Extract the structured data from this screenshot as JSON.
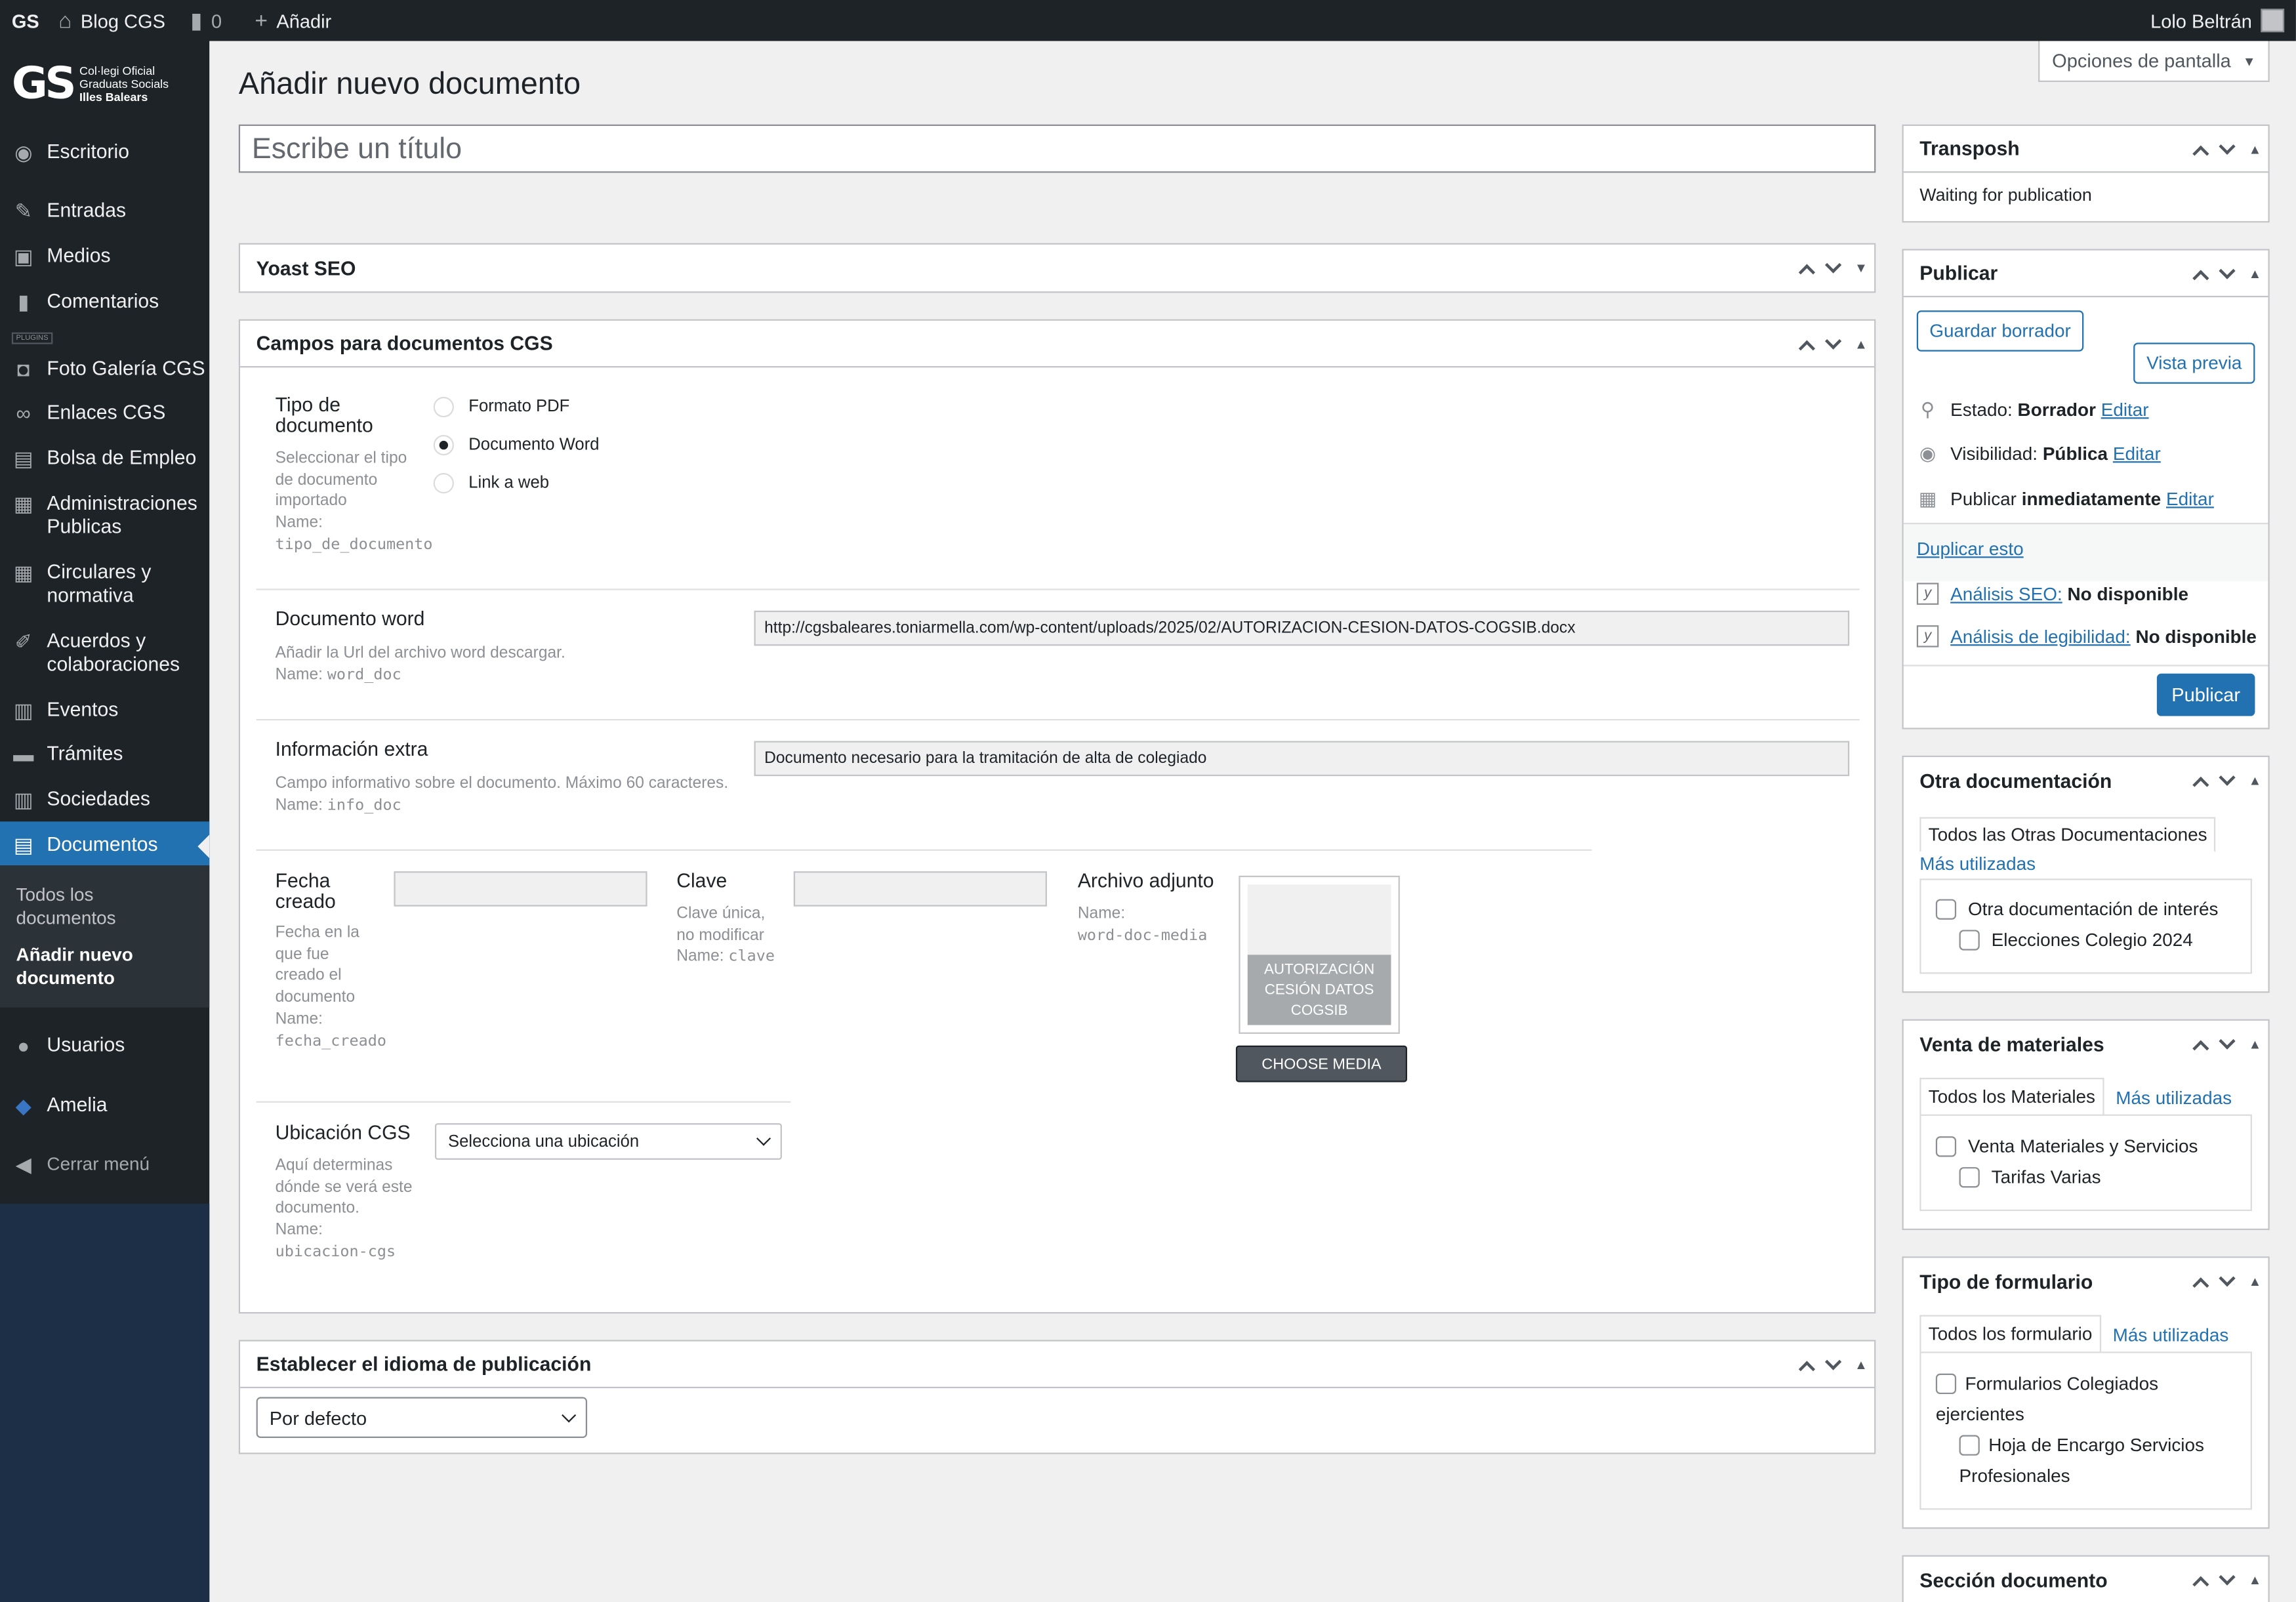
{
  "adminbar": {
    "logo": "GS",
    "site_name": "Blog CGS",
    "comments_count": "0",
    "add_label": "Añadir",
    "user_name": "Lolo Beltrán"
  },
  "brand": {
    "logo_letters": "GS",
    "line1": "Col·legi Oficial",
    "line2": "Graduats Socials",
    "line3": "Illes Balears"
  },
  "sidebar": {
    "items": [
      {
        "label": "Escritorio",
        "icon": "dashboard-icon"
      },
      {
        "label": "Entradas",
        "icon": "pin-icon"
      },
      {
        "label": "Medios",
        "icon": "media-icon"
      },
      {
        "label": "Comentarios",
        "icon": "comment-icon"
      },
      {
        "label": "Foto Galería CGS",
        "icon": "camera-icon"
      },
      {
        "label": "Enlaces CGS",
        "icon": "link-icon"
      },
      {
        "label": "Bolsa de Empleo",
        "icon": "portfolio-icon"
      },
      {
        "label": "Administraciones Publicas",
        "icon": "document-icon"
      },
      {
        "label": "Circulares y normativa",
        "icon": "document-icon"
      },
      {
        "label": "Acuerdos y colaboraciones",
        "icon": "edit-icon"
      },
      {
        "label": "Eventos",
        "icon": "calendar-icon"
      },
      {
        "label": "Trámites",
        "icon": "feedback-icon"
      },
      {
        "label": "Sociedades",
        "icon": "building-icon"
      },
      {
        "label": "Documentos",
        "icon": "documents-icon"
      },
      {
        "label": "Usuarios",
        "icon": "user-icon"
      },
      {
        "label": "Amelia",
        "icon": "amelia-icon"
      },
      {
        "label": "Cerrar menú",
        "icon": "collapse-icon"
      }
    ],
    "plugins_separator": "PLUGINS",
    "submenu": [
      "Todos los documentos",
      "Añadir nuevo documento"
    ]
  },
  "screen_options": "Opciones de pantalla",
  "page_title": "Añadir nuevo documento",
  "title_placeholder": "Escribe un título",
  "yoast_box": {
    "title": "Yoast SEO"
  },
  "fields_box": {
    "title": "Campos para documentos CGS",
    "tipo": {
      "label": "Tipo de documento",
      "desc": "Seleccionar el tipo de documento importado",
      "name_prefix": "Name:",
      "name": "tipo_de_documento",
      "options": [
        "Formato PDF",
        "Documento Word",
        "Link a web"
      ],
      "selected": "Documento Word"
    },
    "word": {
      "label": "Documento word",
      "desc": "Añadir la Url del archivo word descargar.",
      "name_prefix": "Name:",
      "name": "word_doc",
      "value": "http://cgsbaleares.toniarmella.com/wp-content/uploads/2025/02/AUTORIZACION-CESION-DATOS-COGSIB.docx"
    },
    "info": {
      "label": "Información extra",
      "desc": "Campo informativo sobre el documento. Máximo 60 caracteres.",
      "name_prefix": "Name:",
      "name": "info_doc",
      "value": "Documento necesario para la tramitación de alta de colegiado"
    },
    "fecha": {
      "label": "Fecha creado",
      "desc": "Fecha en la que fue creado el documento",
      "name_prefix": "Name:",
      "name": "fecha_creado",
      "value": ""
    },
    "clave": {
      "label": "Clave",
      "desc": "Clave única, no modificar",
      "name_prefix": "Name:",
      "name": "clave",
      "value": ""
    },
    "archivo": {
      "label": "Archivo adjunto",
      "name_prefix": "Name:",
      "name": "word-doc-media",
      "media_title": "AUTORIZACIÓN CESIÓN DATOS COGSIB",
      "button": "CHOOSE MEDIA"
    },
    "ubicacion": {
      "label": "Ubicación CGS",
      "desc": "Aquí determinas dónde se verá este documento.",
      "name_prefix": "Name:",
      "name": "ubicacion-cgs",
      "selected": "Selecciona una ubicación"
    }
  },
  "language_box": {
    "title": "Establecer el idioma de publicación",
    "selected": "Por defecto"
  },
  "transposh_box": {
    "title": "Transposh",
    "status": "Waiting for publication"
  },
  "publish_box": {
    "title": "Publicar",
    "save_draft": "Guardar borrador",
    "preview": "Vista previa",
    "status_label": "Estado:",
    "status_value": "Borrador",
    "visibility_label": "Visibilidad:",
    "visibility_value": "Pública",
    "publish_label": "Publicar",
    "publish_value": "inmediatamente",
    "edit": "Editar",
    "duplicate": "Duplicar esto",
    "seo_label": "Análisis SEO:",
    "seo_value": "No disponible",
    "read_label": "Análisis de legibilidad:",
    "read_value": "No disponible",
    "publish_button": "Publicar"
  },
  "otra_box": {
    "title": "Otra documentación",
    "tab_all": "Todos las Otras Documentaciones",
    "tab_used": "Más utilizadas",
    "items": [
      "Otra documentación de interés",
      "Elecciones Colegio 2024"
    ]
  },
  "venta_box": {
    "title": "Venta de materiales",
    "tab_all": "Todos los Materiales",
    "tab_used": "Más utilizadas",
    "items": [
      "Venta Materiales y Servicios",
      "Tarifas Varias"
    ]
  },
  "form_box": {
    "title": "Tipo de formulario",
    "tab_all": "Todos los formulario",
    "tab_used": "Más utilizadas",
    "items": [
      "Formularios Colegiados ejercientes",
      "Hoja de Encargo Servicios Profesionales"
    ]
  },
  "seccion_box": {
    "title": "Sección documento"
  },
  "colors": {
    "accent": "#2271b1",
    "sidebar": "#1d2327",
    "background": "#f0f0f1"
  }
}
